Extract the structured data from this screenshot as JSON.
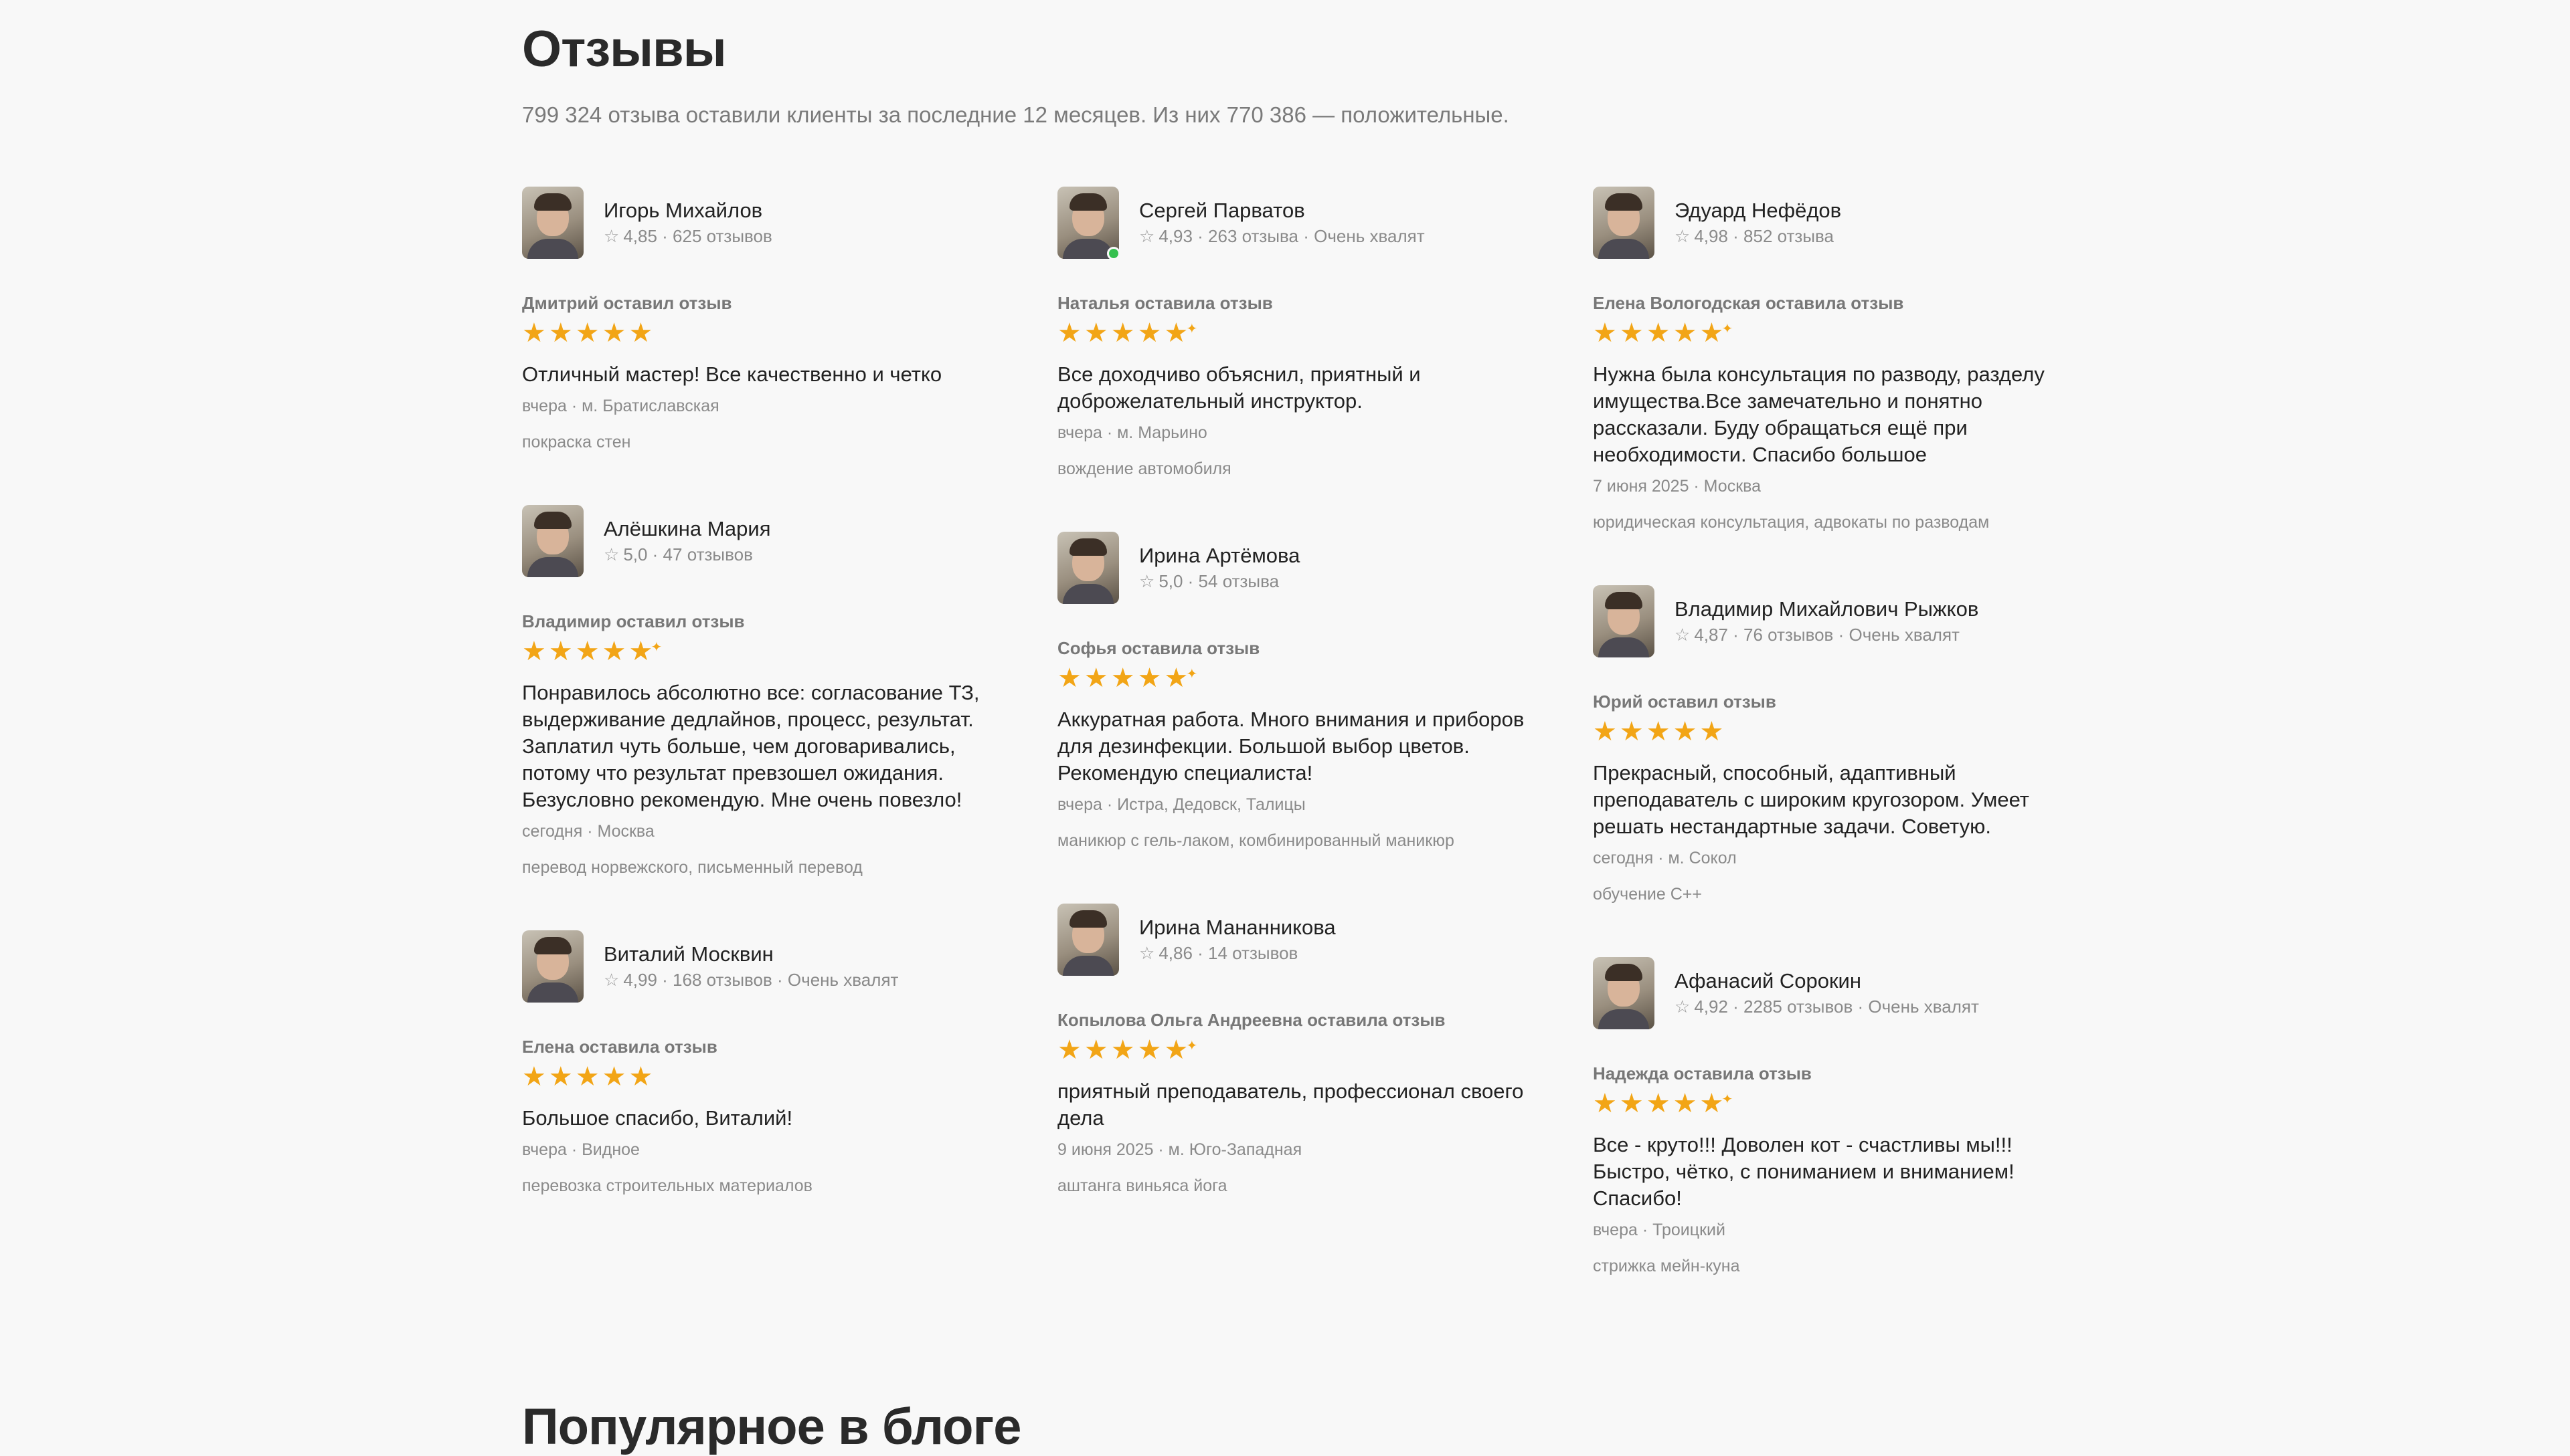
{
  "page": {
    "title": "Отзывы",
    "subtitle": "799 324 отзыва оставили клиенты за последние 12 месяцев. Из них 770 386 — положительные.",
    "blog_title": "Популярное в блоге"
  },
  "colors": {
    "star": "#f2a516",
    "online": "#35c04f",
    "muted_text": "#8a8a8a"
  },
  "columns": [
    [
      {
        "name": "Игорь Михайлов",
        "rating": "4,85",
        "count": "625 отзывов",
        "praise": "",
        "online": false,
        "reviewer": "Дмитрий оставил отзыв",
        "stars": 5,
        "text": "Отличный мастер! Все качественно и четко",
        "when": "вчера · м. Братиславская",
        "service": "покраска стен"
      },
      {
        "name": "Алёшкина Мария",
        "rating": "5,0",
        "count": "47 отзывов",
        "praise": "",
        "online": false,
        "reviewer": "Владимир оставил отзыв",
        "stars": 4.5,
        "text": "Понравилось абсолютно все: согласование ТЗ, выдерживание дедлайнов, процесс, результат. Заплатил чуть больше, чем договаривались, потому что результат превзошел ожидания. Безусловно рекомендую. Мне очень повезло!",
        "when": "сегодня · Москва",
        "service": "перевод норвежского, письменный перевод"
      },
      {
        "name": "Виталий Москвин",
        "rating": "4,99",
        "count": "168 отзывов",
        "praise": "Очень хвалят",
        "online": false,
        "reviewer": "Елена оставила отзыв",
        "stars": 5,
        "text": "Большое спасибо, Виталий!",
        "when": "вчера · Видное",
        "service": "перевозка строительных материалов"
      }
    ],
    [
      {
        "name": "Сергей Парватов",
        "rating": "4,93",
        "count": "263 отзыва",
        "praise": "Очень хвалят",
        "online": true,
        "reviewer": "Наталья оставила отзыв",
        "stars": 4.5,
        "text": "Все доходчиво объяснил, приятный и доброжелательный инструктор.",
        "when": "вчера · м. Марьино",
        "service": "вождение автомобиля"
      },
      {
        "name": "Ирина Артёмова",
        "rating": "5,0",
        "count": "54 отзыва",
        "praise": "",
        "online": false,
        "reviewer": "Софья оставила отзыв",
        "stars": 4.5,
        "text": "Аккуратная работа. Много внимания и приборов для дезинфекции. Большой выбор цветов. Рекомендую специалиста!",
        "when": "вчера · Истра, Дедовск, Талицы",
        "service": "маникюр с гель-лаком, комбинированный маникюр"
      },
      {
        "name": "Ирина Мананникова",
        "rating": "4,86",
        "count": "14 отзывов",
        "praise": "",
        "online": false,
        "reviewer": "Копылова Ольга Андреевна оставила отзыв",
        "stars": 4.5,
        "text": "приятный преподаватель, профессионал своего дела",
        "when": "9 июня 2025 · м. Юго-Западная",
        "service": "аштанга виньяса йога"
      }
    ],
    [
      {
        "name": "Эдуард Нефёдов",
        "rating": "4,98",
        "count": "852 отзыва",
        "praise": "",
        "online": false,
        "reviewer": "Елена Вологодская оставила отзыв",
        "stars": 4.5,
        "text": "Нужна была консультация по разводу, разделу имущества.Все замечательно и понятно рассказали. Буду обращаться ещё при необходимости. Спасибо большое",
        "when": "7 июня 2025 · Москва",
        "service": "юридическая консультация, адвокаты по разводам"
      },
      {
        "name": "Владимир Михайлович Рыжков",
        "rating": "4,87",
        "count": "76 отзывов",
        "praise": "Очень хвалят",
        "online": false,
        "reviewer": "Юрий оставил отзыв",
        "stars": 5,
        "text": "Прекрасный, способный, адаптивный преподаватель с широким кругозором. Умеет решать нестандартные задачи. Советую.",
        "when": "сегодня · м. Сокол",
        "service": "обучение C++"
      },
      {
        "name": "Афанасий Сорокин",
        "rating": "4,92",
        "count": "2285 отзывов",
        "praise": "Очень хвалят",
        "online": false,
        "reviewer": "Надежда оставила отзыв",
        "stars": 4.5,
        "text": "Все - круто!!! Доволен кот - счастливы мы!!! Быстро, чётко, с пониманием и вниманием! Спасибо!",
        "when": "вчера · Троицкий",
        "service": "стрижка мейн-куна"
      }
    ]
  ]
}
